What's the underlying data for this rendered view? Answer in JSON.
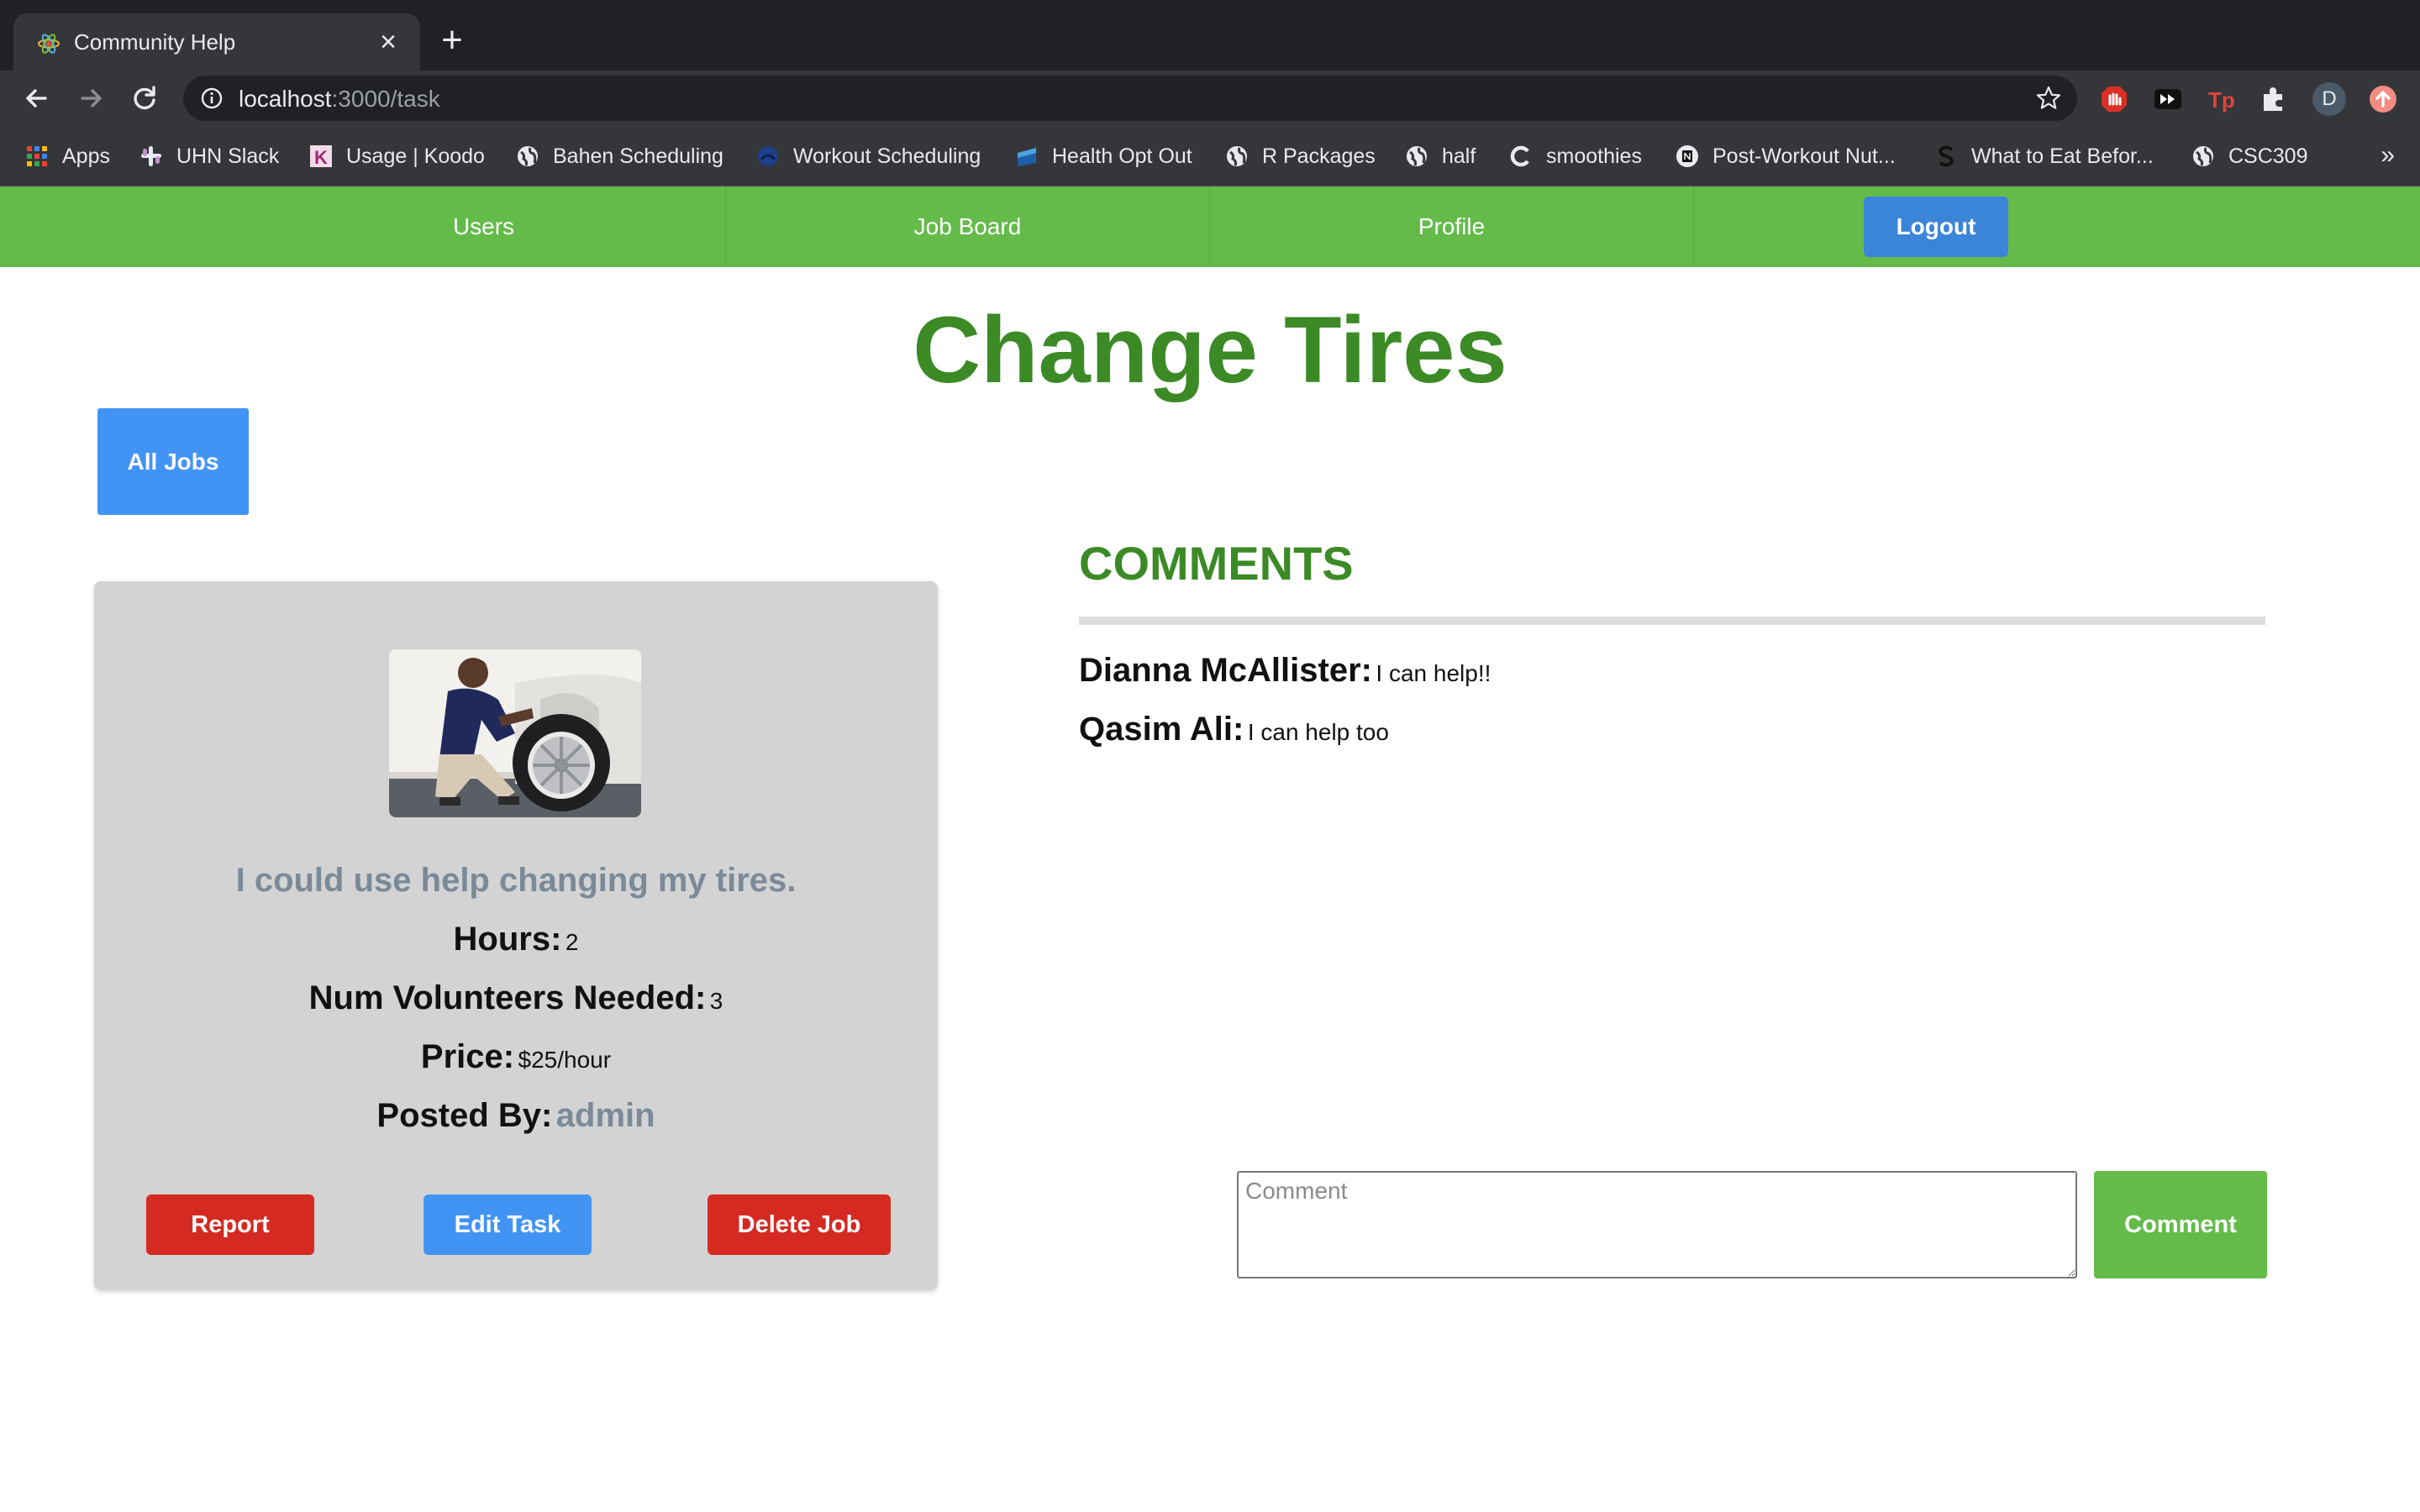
{
  "browser": {
    "tab_title": "Community Help",
    "close_glyph": "×",
    "new_tab_glyph": "+",
    "url_host": "localhost",
    "url_path": ":3000/task",
    "more_bookmarks_glyph": "»",
    "bookmarks": [
      {
        "label": "Apps",
        "icon": "apps-grid-icon"
      },
      {
        "label": "UHN Slack",
        "icon": "slack-icon"
      },
      {
        "label": "Usage | Koodo",
        "icon": "koodo-icon"
      },
      {
        "label": "Bahen Scheduling",
        "icon": "globe-icon"
      },
      {
        "label": "Workout Scheduling",
        "icon": "workout-icon"
      },
      {
        "label": "Health Opt Out",
        "icon": "health-icon"
      },
      {
        "label": "R Packages",
        "icon": "globe-icon"
      },
      {
        "label": "half",
        "icon": "globe-icon"
      },
      {
        "label": "smoothies",
        "icon": "c-icon"
      },
      {
        "label": "Post-Workout Nut...",
        "icon": "notion-icon"
      },
      {
        "label": "What to Eat Befor...",
        "icon": "s-icon"
      },
      {
        "label": "CSC309",
        "icon": "globe-icon"
      }
    ],
    "profile_initial": "D"
  },
  "nav": {
    "items": [
      "Users",
      "Job Board",
      "Profile"
    ],
    "logout_label": "Logout"
  },
  "page": {
    "title": "Change Tires",
    "all_jobs_label": "All Jobs"
  },
  "job": {
    "description": "I could use help changing my tires.",
    "hours_label": "Hours:",
    "hours_value": "2",
    "volunteers_label": "Num Volunteers Needed:",
    "volunteers_value": "3",
    "price_label": "Price:",
    "price_value": "$25/hour",
    "posted_by_label": "Posted By:",
    "posted_by_value": "admin",
    "report_label": "Report",
    "edit_label": "Edit Task",
    "delete_label": "Delete Job"
  },
  "comments": {
    "heading": "COMMENTS",
    "items": [
      {
        "author": "Dianna McAllister:",
        "text": "I can help!!"
      },
      {
        "author": "Qasim Ali:",
        "text": "I can help too"
      }
    ],
    "input_placeholder": "Comment",
    "submit_label": "Comment"
  },
  "colors": {
    "nav_green": "#64bb4a",
    "title_green": "#3b8a26",
    "primary_blue": "#4294f4",
    "danger_red": "#d42a22",
    "card_gray": "#d3d3d3"
  }
}
